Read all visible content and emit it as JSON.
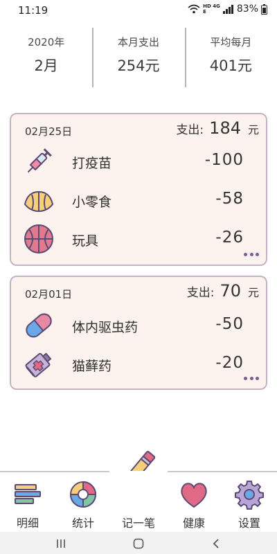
{
  "status_bar": {
    "time": "11:19",
    "network_top": "HD 4G",
    "network_bottom": "E",
    "battery": "83%"
  },
  "summary": {
    "year": "2020年",
    "month": "2月",
    "monthly_expense_label": "本月支出",
    "monthly_expense_value": "254元",
    "average_label": "平均每月",
    "average_value": "401元"
  },
  "days": [
    {
      "date": "02月25日",
      "total_label": "支出:",
      "total": "184",
      "unit": "元",
      "entries": [
        {
          "name": "打疫苗",
          "amount": "-100",
          "icon": "syringe-icon"
        },
        {
          "name": "小零食",
          "amount": "-58",
          "icon": "croissant-icon"
        },
        {
          "name": "玩具",
          "amount": "-26",
          "icon": "ball-icon"
        }
      ]
    },
    {
      "date": "02月01日",
      "total_label": "支出:",
      "total": "70",
      "unit": "元",
      "entries": [
        {
          "name": "体内驱虫药",
          "amount": "-50",
          "icon": "capsule-icon"
        },
        {
          "name": "猫藓药",
          "amount": "-20",
          "icon": "ointment-tube-icon"
        }
      ]
    }
  ],
  "tabs": [
    {
      "label": "明细",
      "icon": "list-icon",
      "active": true
    },
    {
      "label": "统计",
      "icon": "pie-chart-icon",
      "active": false
    },
    {
      "label": "记一笔",
      "icon": "pencil-icon",
      "active": false
    },
    {
      "label": "健康",
      "icon": "heart-icon",
      "active": false
    },
    {
      "label": "设置",
      "icon": "gear-icon",
      "active": false
    }
  ],
  "colors": {
    "card_bg": "#fdf3ee",
    "card_border": "#c4b2c7",
    "accent_purple": "#7a5c93"
  }
}
